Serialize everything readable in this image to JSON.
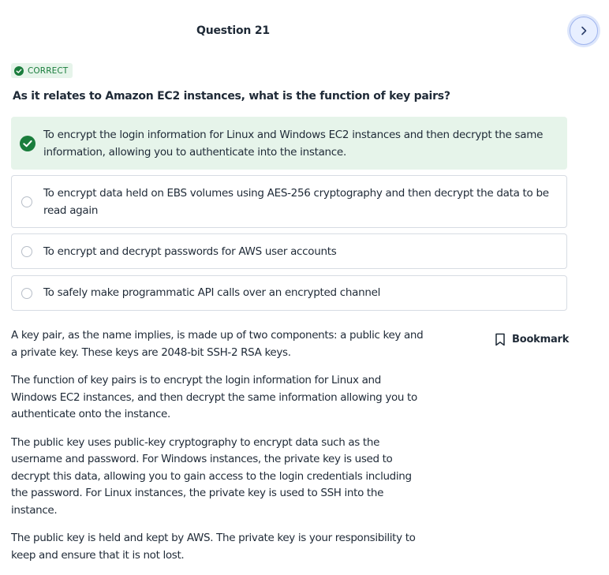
{
  "header": {
    "question_number": "Question 21"
  },
  "status": {
    "badge_label": "CORRECT",
    "color": "#1a7d3c"
  },
  "question": {
    "text": "As it relates to Amazon EC2 instances, what is the function of key pairs?"
  },
  "options": [
    {
      "text": "To encrypt the login information for Linux and Windows EC2 instances and then decrypt the same information, allowing you to authenticate into the instance.",
      "selected": true,
      "correct": true
    },
    {
      "text": "To encrypt data held on EBS volumes using AES-256 cryptography and then decrypt the data to be read again",
      "selected": false,
      "correct": false
    },
    {
      "text": "To encrypt and decrypt passwords for AWS user accounts",
      "selected": false,
      "correct": false
    },
    {
      "text": "To safely make programmatic API calls over an encrypted channel",
      "selected": false,
      "correct": false
    }
  ],
  "bookmark": {
    "label": "Bookmark",
    "icon": "bookmark-icon"
  },
  "explanation": [
    "A key pair, as the name implies, is made up of two components: a public key and a private key. These keys are 2048-bit SSH-2 RSA keys.",
    "The function of key pairs is to encrypt the login information for Linux and Windows EC2 instances, and then decrypt the same information allowing you to authenticate onto the instance.",
    "The public key uses public-key cryptography to encrypt data such as the username and password. For Windows instances, the private key is used to decrypt this data, allowing you to gain access to the login credentials including the password. For Linux instances, the private key is used to SSH into the instance.",
    "The public key is held and kept by AWS. The private key is your responsibility to keep and ensure that it is not lost."
  ]
}
